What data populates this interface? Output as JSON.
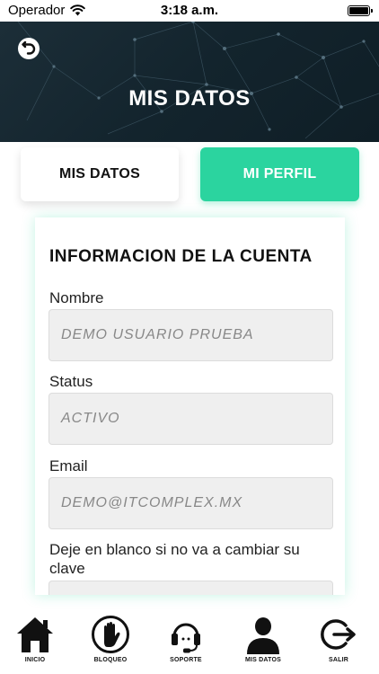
{
  "status_bar": {
    "carrier": "Operador",
    "time": "3:18 a.m."
  },
  "header": {
    "title": "MIS DATOS"
  },
  "tabs": [
    {
      "label": "MIS DATOS",
      "active": false
    },
    {
      "label": "MI PERFIL",
      "active": true
    }
  ],
  "card": {
    "title": "INFORMACION DE LA CUENTA",
    "fields": [
      {
        "label": "Nombre",
        "value": "DEMO USUARIO PRUEBA"
      },
      {
        "label": "Status",
        "value": "ACTIVO"
      },
      {
        "label": "Email",
        "value": "DEMO@ITCOMPLEX.MX"
      },
      {
        "label": "Deje en blanco si no va a cambiar su clave",
        "value": ""
      }
    ]
  },
  "bottom_nav": [
    {
      "label": "INICIO",
      "icon": "home-icon"
    },
    {
      "label": "BLOQUEO",
      "icon": "hand-stop-icon"
    },
    {
      "label": "SOPORTE",
      "icon": "headset-icon"
    },
    {
      "label": "MIS DATOS",
      "icon": "user-icon"
    },
    {
      "label": "SALIR",
      "icon": "exit-icon"
    }
  ],
  "colors": {
    "accent": "#2bd49f",
    "header_bg": "#15262f",
    "input_bg": "#efefef"
  }
}
